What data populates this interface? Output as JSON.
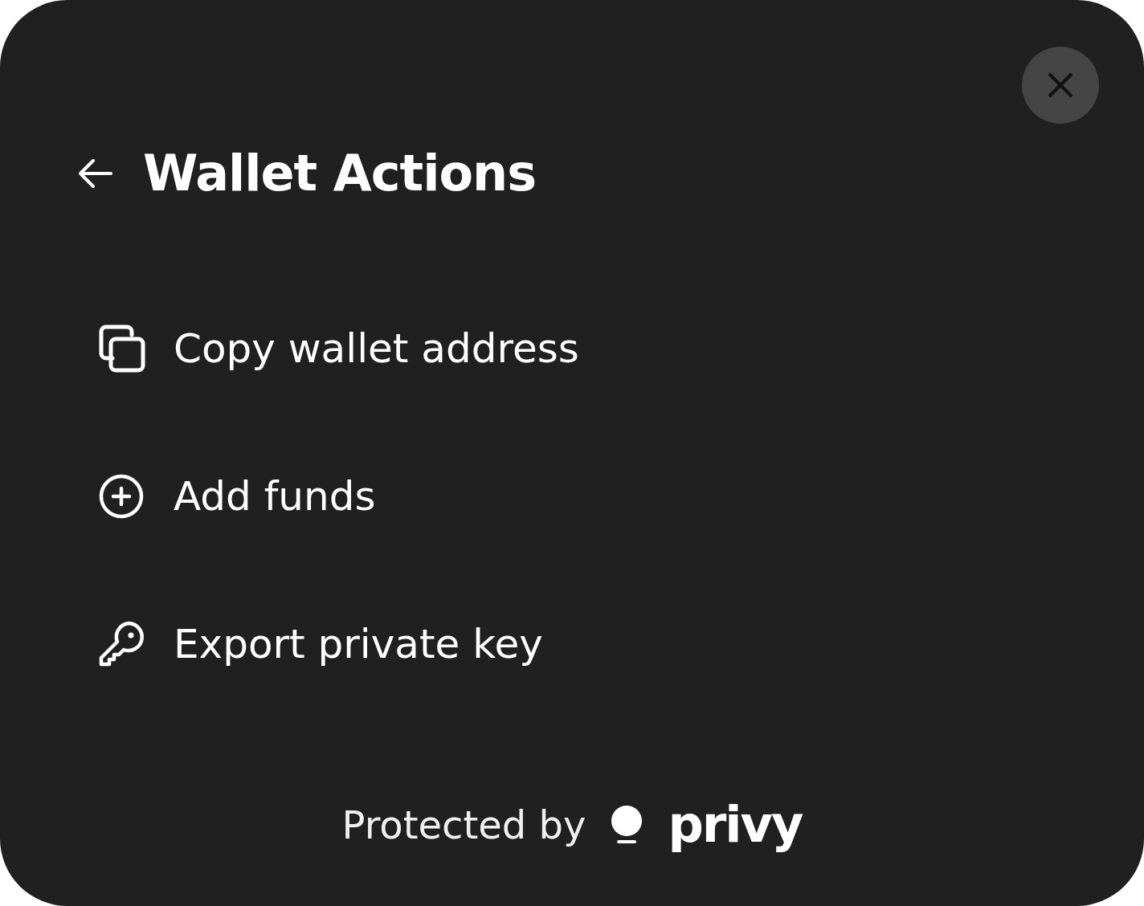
{
  "header": {
    "title": "Wallet Actions"
  },
  "actions": [
    {
      "kind": "copy",
      "label": "Copy wallet address"
    },
    {
      "kind": "add",
      "label": "Add funds"
    },
    {
      "kind": "key",
      "label": "Export private key"
    }
  ],
  "footer": {
    "text": "Protected by",
    "brand": "privy"
  }
}
